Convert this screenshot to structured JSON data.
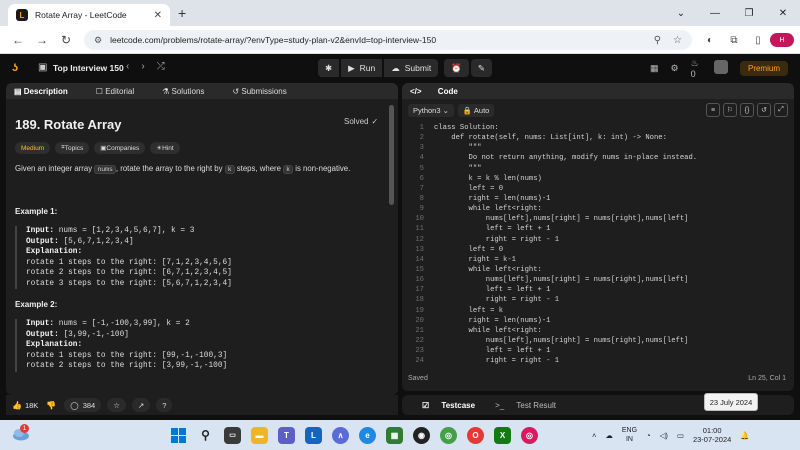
{
  "browser": {
    "tab_title": "Rotate Array - LeetCode",
    "url": "leetcode.com/problems/rotate-array/?envType=study-plan-v2&envId=top-interview-150",
    "profile_initial": "H"
  },
  "lc_nav": {
    "study_plan_title": "Top Interview 150",
    "run_label": "Run",
    "submit_label": "Submit",
    "streak_count": "0",
    "premium_label": "Premium"
  },
  "left_tabs": [
    "Description",
    "Editorial",
    "Solutions",
    "Submissions"
  ],
  "problem": {
    "title": "189. Rotate Array",
    "status": "Solved",
    "difficulty": "Medium",
    "tags": [
      "Topics",
      "Companies",
      "Hint"
    ],
    "desc_prefix": "Given an integer array ",
    "desc_code1": "nums",
    "desc_mid": ", rotate the array to the right by ",
    "desc_code2": "k",
    "desc_mid2": " steps, where ",
    "desc_code3": "k",
    "desc_suffix": " is non-negative.",
    "examples": [
      {
        "title": "Example 1:",
        "input_label": "Input:",
        "input": " nums = [1,2,3,4,5,6,7], k = 3",
        "output_label": "Output:",
        "output": " [5,6,7,1,2,3,4]",
        "expl_label": "Explanation:",
        "lines": [
          "rotate 1 steps to the right: [7,1,2,3,4,5,6]",
          "rotate 2 steps to the right: [6,7,1,2,3,4,5]",
          "rotate 3 steps to the right: [5,6,7,1,2,3,4]"
        ]
      },
      {
        "title": "Example 2:",
        "input_label": "Input:",
        "input": " nums = [-1,-100,3,99], k = 2",
        "output_label": "Output:",
        "output": " [3,99,-1,-100]",
        "expl_label": "Explanation:",
        "lines": [
          "rotate 1 steps to the right: [99,-1,-100,3]",
          "rotate 2 steps to the right: [3,99,-1,-100]"
        ]
      }
    ]
  },
  "footer": {
    "likes": "18K",
    "comments": "384"
  },
  "code_panel": {
    "title": "Code",
    "language": "Python3",
    "mode": "Auto",
    "saved": "Saved",
    "cursor": "Ln 25, Col 1",
    "lines": [
      "class Solution:",
      "    def rotate(self, nums: List[int], k: int) -> None:",
      "        \"\"\"",
      "        Do not return anything, modify nums in-place instead.",
      "        \"\"\"",
      "        k = k % len(nums)",
      "        left = 0",
      "        right = len(nums)-1",
      "        while left<right:",
      "            nums[left],nums[right] = nums[right],nums[left]",
      "            left = left + 1",
      "            right = right - 1",
      "        left = 0",
      "        right = k-1",
      "        while left<right:",
      "            nums[left],nums[right] = nums[right],nums[left]",
      "            left = left + 1",
      "            right = right - 1",
      "        left = k",
      "        right = len(nums)-1",
      "        while left<right:",
      "            nums[left],nums[right] = nums[right],nums[left]",
      "            left = left + 1",
      "            right = right - 1"
    ]
  },
  "test_bar": {
    "testcase": "Testcase",
    "result": "Test Result"
  },
  "tooltip": "23 July 2024",
  "taskbar": {
    "weather_badge": "1",
    "lang_top": "ENG",
    "lang_bottom": "IN",
    "time": "01:00",
    "date": "23-07-2024"
  }
}
